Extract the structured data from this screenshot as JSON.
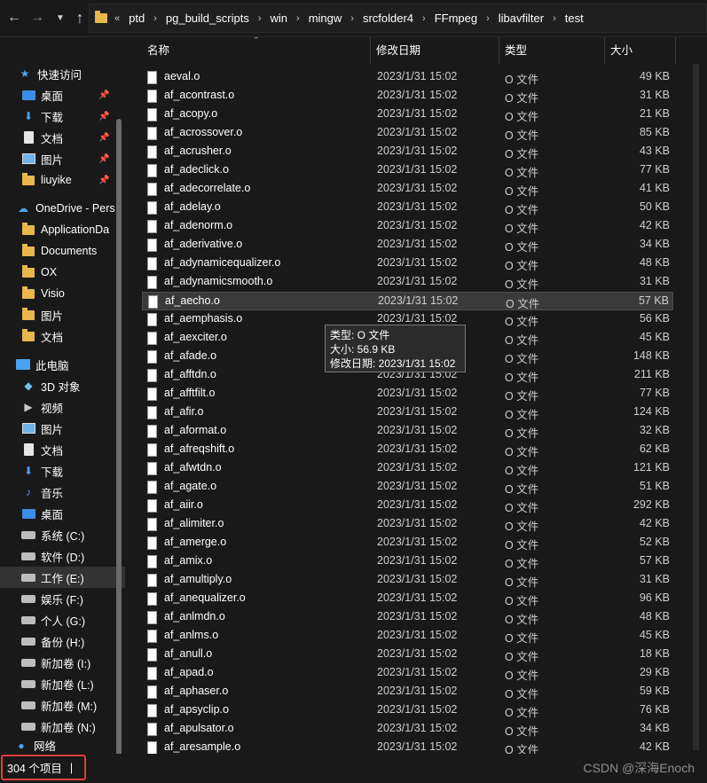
{
  "breadcrumb": {
    "overflow": "«",
    "items": [
      "ptd",
      "pg_build_scripts",
      "win",
      "mingw",
      "srcfolder4",
      "FFmpeg",
      "libavfilter",
      "test"
    ]
  },
  "sidebar": {
    "items": [
      {
        "label": "快速访问",
        "icon": "star-icon",
        "pinned": false
      },
      {
        "label": "桌面",
        "icon": "desktop-icon",
        "pinned": true
      },
      {
        "label": "下载",
        "icon": "download-icon",
        "pinned": true
      },
      {
        "label": "文档",
        "icon": "document-icon",
        "pinned": true
      },
      {
        "label": "图片",
        "icon": "picture-icon",
        "pinned": true
      },
      {
        "label": "liuyike",
        "icon": "folder-icon",
        "pinned": true
      },
      {
        "label": "OneDrive - Pers",
        "icon": "cloud-icon",
        "pinned": false
      },
      {
        "label": "ApplicationDa",
        "icon": "folder-icon",
        "pinned": false
      },
      {
        "label": "Documents",
        "icon": "folder-icon",
        "pinned": false
      },
      {
        "label": "OX",
        "icon": "folder-icon",
        "pinned": false
      },
      {
        "label": "Visio",
        "icon": "folder-icon",
        "pinned": false
      },
      {
        "label": "图片",
        "icon": "folder-icon",
        "pinned": false
      },
      {
        "label": "文档",
        "icon": "folder-icon",
        "pinned": false
      },
      {
        "label": "此电脑",
        "icon": "pc-icon",
        "pinned": false
      },
      {
        "label": "3D 对象",
        "icon": "cube-icon",
        "pinned": false
      },
      {
        "label": "视频",
        "icon": "video-icon",
        "pinned": false
      },
      {
        "label": "图片",
        "icon": "picture-icon",
        "pinned": false
      },
      {
        "label": "文档",
        "icon": "document-icon",
        "pinned": false
      },
      {
        "label": "下载",
        "icon": "download-icon",
        "pinned": false
      },
      {
        "label": "音乐",
        "icon": "music-icon",
        "pinned": false
      },
      {
        "label": "桌面",
        "icon": "desktop-icon",
        "pinned": false
      },
      {
        "label": "系统 (C:)",
        "icon": "drive-icon",
        "pinned": false
      },
      {
        "label": "软件 (D:)",
        "icon": "drive-icon",
        "pinned": false
      },
      {
        "label": "工作 (E:)",
        "icon": "drive-icon",
        "pinned": false,
        "selected": true
      },
      {
        "label": "娱乐 (F:)",
        "icon": "drive-icon",
        "pinned": false
      },
      {
        "label": "个人 (G:)",
        "icon": "drive-icon",
        "pinned": false
      },
      {
        "label": "备份 (H:)",
        "icon": "drive-icon",
        "pinned": false
      },
      {
        "label": "新加卷 (I:)",
        "icon": "drive-icon",
        "pinned": false
      },
      {
        "label": "新加卷 (L:)",
        "icon": "drive-icon",
        "pinned": false
      },
      {
        "label": "新加卷 (M:)",
        "icon": "drive-icon",
        "pinned": false
      },
      {
        "label": "新加卷 (N:)",
        "icon": "drive-icon",
        "pinned": false
      }
    ],
    "network": "网络"
  },
  "columns": {
    "name": "名称",
    "date": "修改日期",
    "type": "类型",
    "size": "大小"
  },
  "files": [
    {
      "name": "aeval.o",
      "date": "2023/1/31 15:02",
      "type": "O 文件",
      "size": "49 KB"
    },
    {
      "name": "af_acontrast.o",
      "date": "2023/1/31 15:02",
      "type": "O 文件",
      "size": "31 KB"
    },
    {
      "name": "af_acopy.o",
      "date": "2023/1/31 15:02",
      "type": "O 文件",
      "size": "21 KB"
    },
    {
      "name": "af_acrossover.o",
      "date": "2023/1/31 15:02",
      "type": "O 文件",
      "size": "85 KB"
    },
    {
      "name": "af_acrusher.o",
      "date": "2023/1/31 15:02",
      "type": "O 文件",
      "size": "43 KB"
    },
    {
      "name": "af_adeclick.o",
      "date": "2023/1/31 15:02",
      "type": "O 文件",
      "size": "77 KB"
    },
    {
      "name": "af_adecorrelate.o",
      "date": "2023/1/31 15:02",
      "type": "O 文件",
      "size": "41 KB"
    },
    {
      "name": "af_adelay.o",
      "date": "2023/1/31 15:02",
      "type": "O 文件",
      "size": "50 KB"
    },
    {
      "name": "af_adenorm.o",
      "date": "2023/1/31 15:02",
      "type": "O 文件",
      "size": "42 KB"
    },
    {
      "name": "af_aderivative.o",
      "date": "2023/1/31 15:02",
      "type": "O 文件",
      "size": "34 KB"
    },
    {
      "name": "af_adynamicequalizer.o",
      "date": "2023/1/31 15:02",
      "type": "O 文件",
      "size": "48 KB"
    },
    {
      "name": "af_adynamicsmooth.o",
      "date": "2023/1/31 15:02",
      "type": "O 文件",
      "size": "31 KB"
    },
    {
      "name": "af_aecho.o",
      "date": "2023/1/31 15:02",
      "type": "O 文件",
      "size": "57 KB",
      "hover": true
    },
    {
      "name": "af_aemphasis.o",
      "date": "2023/1/31 15:02",
      "type": "O 文件",
      "size": "56 KB"
    },
    {
      "name": "af_aexciter.o",
      "date": "2023/1/31 15:02",
      "type": "O 文件",
      "size": "45 KB"
    },
    {
      "name": "af_afade.o",
      "date": "2023/1/31 15:02",
      "type": "O 文件",
      "size": "148 KB"
    },
    {
      "name": "af_afftdn.o",
      "date": "2023/1/31 15:02",
      "type": "O 文件",
      "size": "211 KB"
    },
    {
      "name": "af_afftfilt.o",
      "date": "2023/1/31 15:02",
      "type": "O 文件",
      "size": "77 KB"
    },
    {
      "name": "af_afir.o",
      "date": "2023/1/31 15:02",
      "type": "O 文件",
      "size": "124 KB"
    },
    {
      "name": "af_aformat.o",
      "date": "2023/1/31 15:02",
      "type": "O 文件",
      "size": "32 KB"
    },
    {
      "name": "af_afreqshift.o",
      "date": "2023/1/31 15:02",
      "type": "O 文件",
      "size": "62 KB"
    },
    {
      "name": "af_afwtdn.o",
      "date": "2023/1/31 15:02",
      "type": "O 文件",
      "size": "121 KB"
    },
    {
      "name": "af_agate.o",
      "date": "2023/1/31 15:02",
      "type": "O 文件",
      "size": "51 KB"
    },
    {
      "name": "af_aiir.o",
      "date": "2023/1/31 15:02",
      "type": "O 文件",
      "size": "292 KB"
    },
    {
      "name": "af_alimiter.o",
      "date": "2023/1/31 15:02",
      "type": "O 文件",
      "size": "42 KB"
    },
    {
      "name": "af_amerge.o",
      "date": "2023/1/31 15:02",
      "type": "O 文件",
      "size": "52 KB"
    },
    {
      "name": "af_amix.o",
      "date": "2023/1/31 15:02",
      "type": "O 文件",
      "size": "57 KB"
    },
    {
      "name": "af_amultiply.o",
      "date": "2023/1/31 15:02",
      "type": "O 文件",
      "size": "31 KB"
    },
    {
      "name": "af_anequalizer.o",
      "date": "2023/1/31 15:02",
      "type": "O 文件",
      "size": "96 KB"
    },
    {
      "name": "af_anlmdn.o",
      "date": "2023/1/31 15:02",
      "type": "O 文件",
      "size": "48 KB"
    },
    {
      "name": "af_anlms.o",
      "date": "2023/1/31 15:02",
      "type": "O 文件",
      "size": "45 KB"
    },
    {
      "name": "af_anull.o",
      "date": "2023/1/31 15:02",
      "type": "O 文件",
      "size": "18 KB"
    },
    {
      "name": "af_apad.o",
      "date": "2023/1/31 15:02",
      "type": "O 文件",
      "size": "29 KB"
    },
    {
      "name": "af_aphaser.o",
      "date": "2023/1/31 15:02",
      "type": "O 文件",
      "size": "59 KB"
    },
    {
      "name": "af_apsyclip.o",
      "date": "2023/1/31 15:02",
      "type": "O 文件",
      "size": "76 KB"
    },
    {
      "name": "af_apulsator.o",
      "date": "2023/1/31 15:02",
      "type": "O 文件",
      "size": "34 KB"
    },
    {
      "name": "af_aresample.o",
      "date": "2023/1/31 15:02",
      "type": "O 文件",
      "size": "42 KB"
    }
  ],
  "tooltip": {
    "type_line": "类型: O 文件",
    "size_line": "大小: 56.9 KB",
    "date_line": "修改日期: 2023/1/31 15:02"
  },
  "status": {
    "count": "304 个项目",
    "separator": "|"
  },
  "watermark": "CSDN @深海Enoch",
  "colors": {
    "background": "#191919",
    "hover": "#3a3a3a",
    "highlight_border": "#e0403a",
    "folder": "#e8b84a"
  }
}
